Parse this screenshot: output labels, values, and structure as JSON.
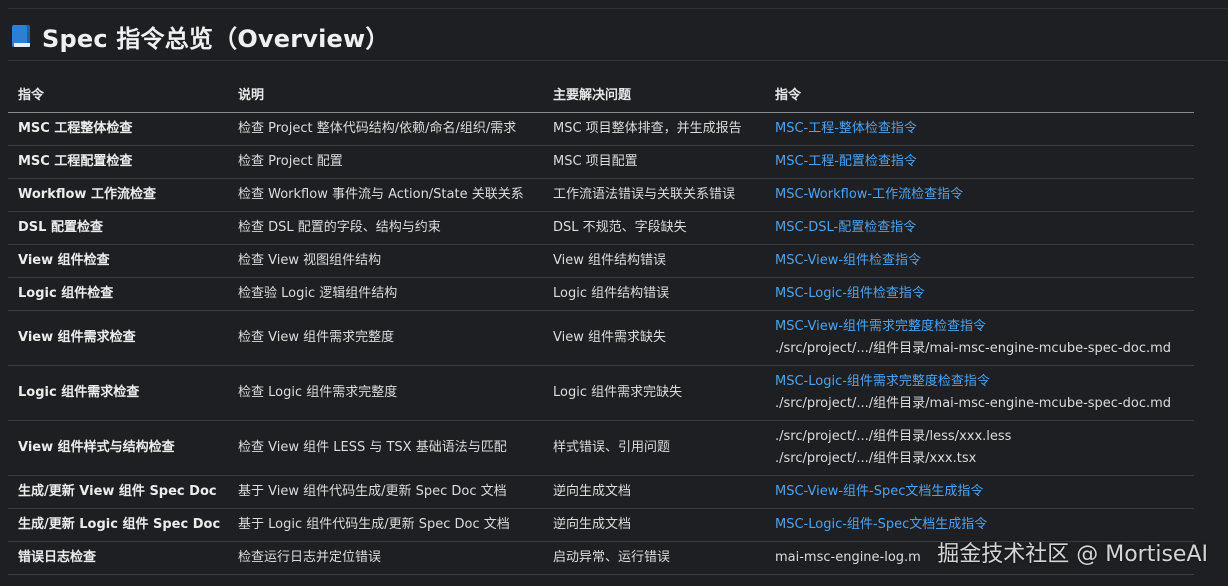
{
  "title": "Spec 指令总览（Overview）",
  "headers": [
    "指令",
    "说明",
    "主要解决问题",
    "指令"
  ],
  "rows": [
    {
      "cmd": "MSC 工程整体检查",
      "desc": "检查 Project 整体代码结构/依赖/命名/组织/需求",
      "problem": "MSC 项目整体排查，并生成报告",
      "ref1": "MSC-工程-整体检查指令",
      "ref2": ""
    },
    {
      "cmd": "MSC 工程配置检查",
      "desc": "检查 Project 配置",
      "problem": "MSC 项目配置",
      "ref1": "MSC-工程-配置检查指令",
      "ref2": ""
    },
    {
      "cmd": "Workflow 工作流检查",
      "desc": "检查 Workflow 事件流与 Action/State 关联关系",
      "problem": "工作流语法错误与关联关系错误",
      "ref1": "MSC-Workflow-工作流检查指令",
      "ref2": ""
    },
    {
      "cmd": "DSL 配置检查",
      "desc": "检查 DSL 配置的字段、结构与约束",
      "problem": "DSL 不规范、字段缺失",
      "ref1": "MSC-DSL-配置检查指令",
      "ref2": ""
    },
    {
      "cmd": "View 组件检查",
      "desc": "检查 View 视图组件结构",
      "problem": "View 组件结构错误",
      "ref1": "MSC-View-组件检查指令",
      "ref2": ""
    },
    {
      "cmd": "Logic 组件检查",
      "desc": "检查验 Logic 逻辑组件结构",
      "problem": "Logic 组件结构错误",
      "ref1": "MSC-Logic-组件检查指令",
      "ref2": ""
    },
    {
      "cmd": "View 组件需求检查",
      "desc": "检查 View 组件需求完整度",
      "problem": "View 组件需求缺失",
      "ref1": "MSC-View-组件需求完整度检查指令",
      "ref2": "./src/project/.../组件目录/mai-msc-engine-mcube-spec-doc.md"
    },
    {
      "cmd": "Logic 组件需求检查",
      "desc": "检查 Logic 组件需求完整度",
      "problem": "Logic 组件需求完缺失",
      "ref1": "MSC-Logic-组件需求完整度检查指令",
      "ref2": "./src/project/.../组件目录/mai-msc-engine-mcube-spec-doc.md"
    },
    {
      "cmd": "View 组件样式与结构检查",
      "desc": "检查 View 组件 LESS 与 TSX 基础语法与匹配",
      "problem": "样式错误、引用问题",
      "ref1": "",
      "ref2": "./src/project/.../组件目录/less/xxx.less",
      "ref3": "./src/project/.../组件目录/xxx.tsx"
    },
    {
      "cmd": "生成/更新 View 组件 Spec Doc",
      "desc": "基于 View 组件代码生成/更新 Spec Doc 文档",
      "problem": "逆向生成文档",
      "ref1": "MSC-View-组件-Spec文档生成指令",
      "ref2": ""
    },
    {
      "cmd": "生成/更新 Logic 组件 Spec Doc",
      "desc": "基于 Logic 组件代码生成/更新 Spec Doc 文档",
      "problem": "逆向生成文档",
      "ref1": "MSC-Logic-组件-Spec文档生成指令",
      "ref2": ""
    },
    {
      "cmd": "错误日志检查",
      "desc": "检查运行日志并定位错误",
      "problem": "启动异常、运行错误",
      "ref1": "",
      "ref2": "mai-msc-engine-log.m"
    }
  ],
  "watermark": "掘金技术社区 @ MortiseAI",
  "colors": {
    "background": "#1e1f22",
    "link": "#4da3f0",
    "text": "#dcdcdc"
  }
}
